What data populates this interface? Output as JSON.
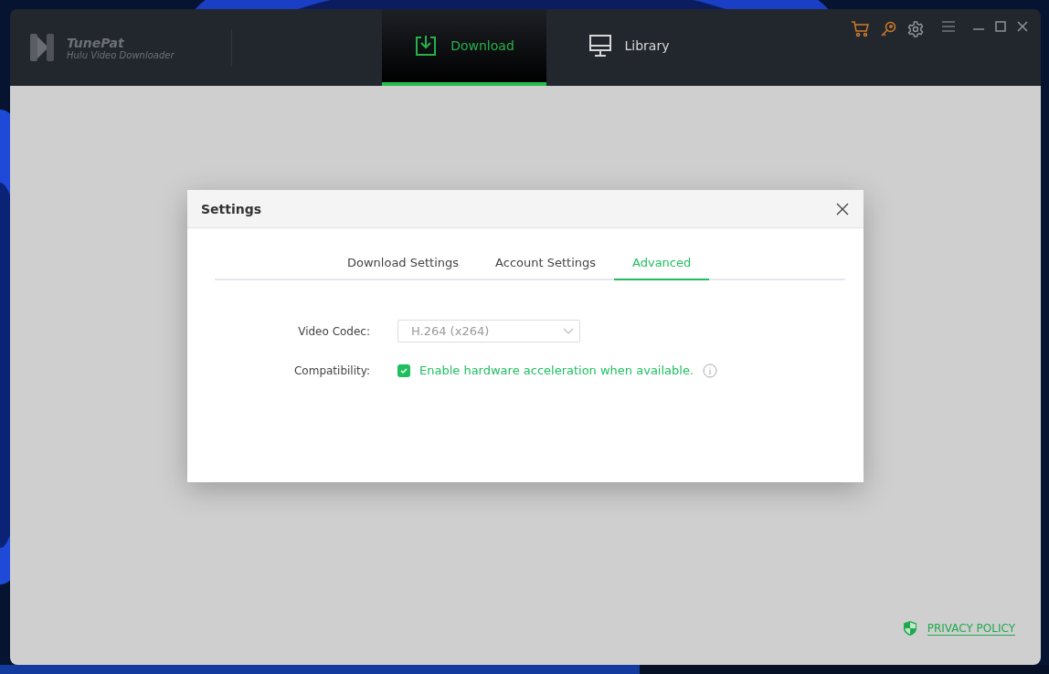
{
  "app": {
    "name": "TunePat",
    "subtitle": "Hulu Video Downloader"
  },
  "nav_tabs": [
    {
      "label": "Download",
      "selected": true
    },
    {
      "label": "Library",
      "selected": false
    }
  ],
  "dialog": {
    "title": "Settings",
    "tabs": [
      {
        "label": "Download Settings",
        "selected": false
      },
      {
        "label": "Account Settings",
        "selected": false
      },
      {
        "label": "Advanced",
        "selected": true
      }
    ],
    "fields": [
      {
        "kind": "select",
        "label": "Video Codec:",
        "value": "H.264 (x264)"
      },
      {
        "kind": "checkbox",
        "label": "Compatibility:",
        "text": "Enable hardware acceleration when available.",
        "checked": true
      }
    ]
  },
  "privacy_link": "PRIVACY POLICY"
}
